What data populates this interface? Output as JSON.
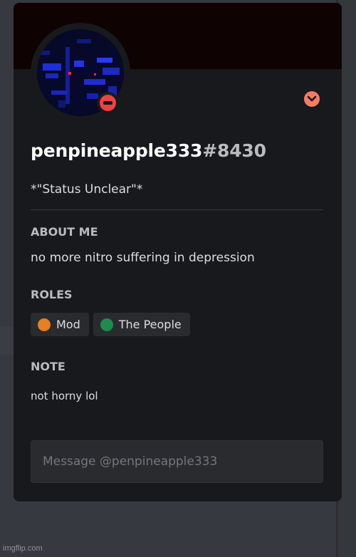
{
  "profile": {
    "username": "penpineapple333",
    "discriminator": "#8430",
    "custom_status": "*\"Status Unclear\"*",
    "status": "do-not-disturb",
    "badge_icon": "chevron-badge-icon"
  },
  "about": {
    "title": "ABOUT ME",
    "text": "no more nitro suffering in depression"
  },
  "roles": {
    "title": "ROLES",
    "items": [
      {
        "name": "Mod",
        "color": "#e67e22"
      },
      {
        "name": "The People",
        "color": "#1f8b4c"
      }
    ]
  },
  "note": {
    "title": "NOTE",
    "text": "not horny lol"
  },
  "message": {
    "placeholder": "Message @penpineapple333"
  },
  "watermark": "imgflip.com",
  "colors": {
    "status_dnd": "#ed4245",
    "badge": "#f47b67",
    "popout_bg": "#18191c"
  }
}
